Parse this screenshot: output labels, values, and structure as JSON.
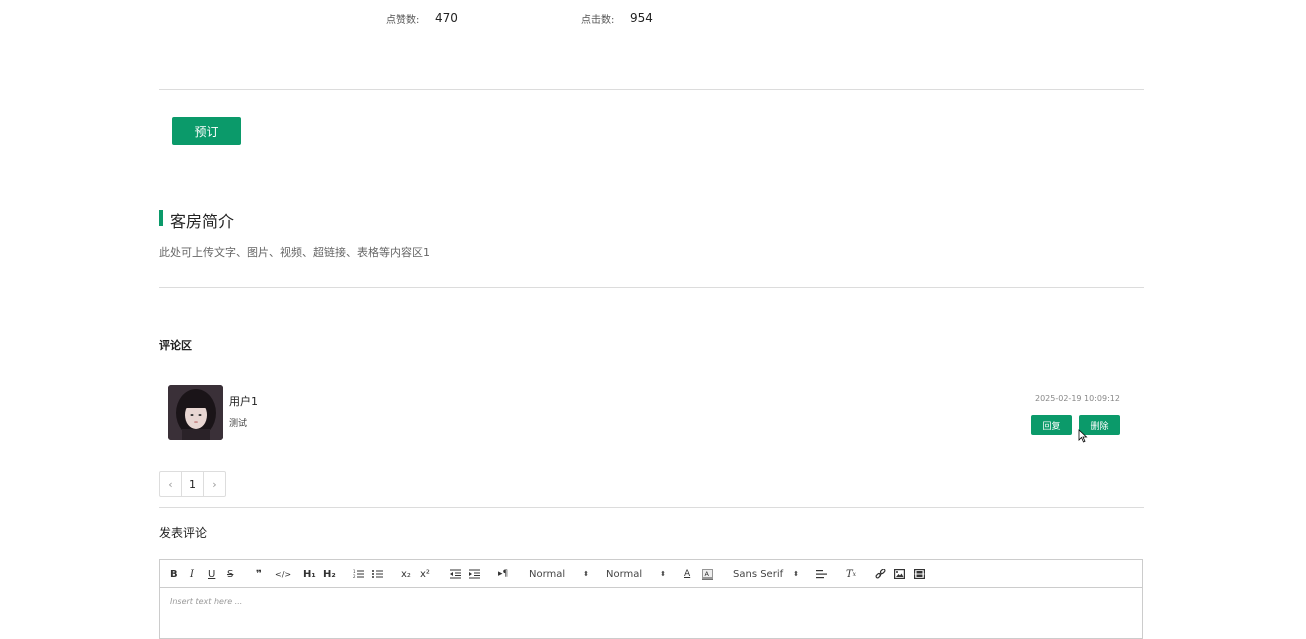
{
  "stats": {
    "likes_label": "点赞数:",
    "likes_value": "470",
    "clicks_label": "点击数:",
    "clicks_value": "954"
  },
  "booking": {
    "label": "预订"
  },
  "room_intro": {
    "title": "客房简介",
    "description": "此处可上传文字、图片、视频、超链接、表格等内容区1"
  },
  "comments": {
    "title": "评论区",
    "items": [
      {
        "username": "用户1",
        "text": "测试",
        "timestamp": "2025-02-19 10:09:12",
        "reply_label": "回复",
        "delete_label": "删除"
      }
    ],
    "pagination": {
      "prev": "‹",
      "current": "1",
      "next": "›"
    }
  },
  "post_comment": {
    "title": "发表评论",
    "toolbar": {
      "header_select": "Normal",
      "size_select": "Normal",
      "font_select": "Sans Serif",
      "h1": "H₁",
      "h2": "H₂",
      "sub": "x₂",
      "sup": "x²"
    },
    "placeholder": "Insert text here ..."
  },
  "colors": {
    "accent": "#0b9a6a",
    "divider": "#dcdcdc"
  },
  "icons": [
    "bold-icon",
    "italic-icon",
    "underline-icon",
    "strike-icon",
    "blockquote-icon",
    "code-block-icon",
    "ordered-list-icon",
    "bullet-list-icon",
    "indent-decrease-icon",
    "indent-increase-icon",
    "text-direction-icon",
    "font-color-icon",
    "background-color-icon",
    "align-icon",
    "clear-format-icon",
    "link-icon",
    "image-icon",
    "video-icon"
  ]
}
